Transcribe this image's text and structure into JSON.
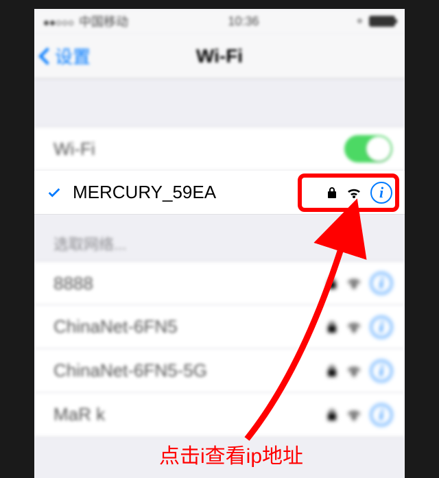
{
  "statusbar": {
    "carrier": "中国移动",
    "time": "10:36"
  },
  "nav": {
    "back_label": "设置",
    "title": "Wi-Fi"
  },
  "wifi_toggle": {
    "label": "Wi-Fi",
    "on": true
  },
  "connected": {
    "name": "MERCURY_59EA"
  },
  "section_header": "选取网络...",
  "networks": [
    {
      "name": "8888"
    },
    {
      "name": "ChinaNet-6FN5"
    },
    {
      "name": "ChinaNet-6FN5-5G"
    },
    {
      "name": "MaR k"
    }
  ],
  "annotation": {
    "caption": "点击i查看ip地址"
  },
  "info_glyph": "i"
}
